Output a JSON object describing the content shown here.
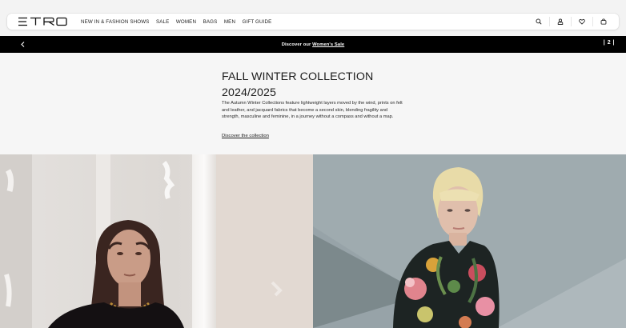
{
  "header": {
    "logo_text": "ETRO",
    "nav": [
      "NEW IN & FASHION SHOWS",
      "SALE",
      "WOMEN",
      "BAGS",
      "MEN",
      "GIFT GUIDE"
    ],
    "icons": [
      "search-icon",
      "account-icon",
      "wishlist-heart-icon",
      "shopping-bag-icon"
    ]
  },
  "promo": {
    "prefix": "Discover our ",
    "link": "Women's Sale",
    "counter": "| 2 |"
  },
  "hero": {
    "title_line1": "FALL WINTER COLLECTION",
    "title_line2": "2024/2025",
    "description": "The Autumn Winter Collections feature lightweight layers moved by the wind, prints on felt and leather, and jacquard fabrics that become a second skin, blending fragility and strength, masculine and feminine, in a journey without a compass and without a map.",
    "link": "Discover the collection"
  },
  "colors": {
    "page_bg": "#ffffff",
    "promo_bg": "#000000",
    "hero_bg": "#f6f6f6",
    "text": "#1c1c1c"
  }
}
